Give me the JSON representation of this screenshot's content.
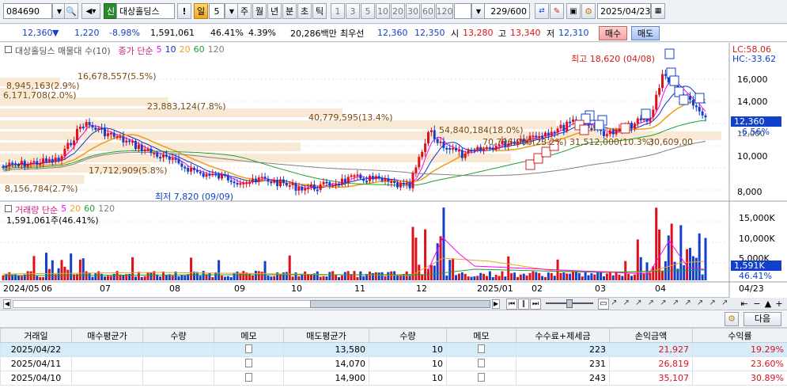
{
  "toolbar": {
    "code": "084690",
    "badge": "신",
    "name": "대상홀딩스",
    "excl": "!",
    "period_sel": "일",
    "period_num": "5",
    "periods": [
      "주",
      "월",
      "년",
      "분",
      "초",
      "틱"
    ],
    "nums": [
      "1",
      "3",
      "5",
      "10",
      "20",
      "30",
      "60",
      "120"
    ],
    "count": "229",
    "count_total": "/600",
    "date": "2025/04/23"
  },
  "quote": {
    "price": "12,360",
    "arrow": "▼",
    "change": "1,220",
    "change_pct": "-8.98%",
    "volume": "1,591,061",
    "vol_ratio": "46.41%",
    "turnover": "4.39%",
    "amount": "20,286백만",
    "best_sell_label": "최우선",
    "best_sell": "12,360",
    "best_buy": "12,350",
    "open_label": "시",
    "open": "13,280",
    "high_label": "고",
    "high": "13,340",
    "low_label": "저",
    "low": "12,310",
    "buy_btn": "매수",
    "sell_btn": "매도"
  },
  "chart": {
    "legend_title": "대상홀딩스 매물대 수(10)",
    "ma_label": "종가 단순",
    "ma_periods": [
      "5",
      "10",
      "20",
      "60",
      "120"
    ],
    "ma_colors": [
      "#ff00ff",
      "#1030d0",
      "#f0a020",
      "#20a030",
      "#808080"
    ],
    "lc": "LC:58.06",
    "hc": "HC:-33.62",
    "price_ticks": [
      "16,000",
      "14,000",
      "12,000",
      "10,000",
      "8,000"
    ],
    "current_tag": "12,360",
    "current_pct": "-6.56%",
    "high_note": "최고 18,620 (04/08)",
    "low_note": "최저 7,820 (09/09)",
    "profile_labels": [
      "16,678,557(5.5%)",
      "8,945,163(2.9%)",
      "6,171,708(2.0%)",
      "23,883,124(7.8%)",
      "40,779,595(13.4%)",
      "54,840,184(18.0%)",
      "70,796,000(23.2%)",
      "31,512,000(10.3%)",
      "17,712,909(5.8%)",
      "8,156,784(2.7%)",
      "30,609,00"
    ],
    "volume_label": "거래량 단순",
    "volume_ma": [
      "5",
      "20",
      "60",
      "120"
    ],
    "volume_sub": "1,591,061주(46.41%)",
    "volume_ticks": [
      "15,000K",
      "10,000K",
      "5,000K"
    ],
    "volume_tag": "1,591K",
    "volume_pct": "46.41%",
    "x_labels": [
      "2024/05",
      "06",
      "07",
      "08",
      "09",
      "10",
      "11",
      "12",
      "2025/01",
      "02",
      "03",
      "04",
      "04/23"
    ],
    "colors": {
      "up": "#e0101a",
      "down": "#1240c8",
      "profile": "#f7e7d0"
    }
  },
  "table": {
    "next_btn": "다음",
    "headers": [
      "거래일",
      "매수평균가",
      "수량",
      "메모",
      "매도평균가",
      "수량",
      "메모",
      "수수료+제세금",
      "손익금액",
      "수익률"
    ],
    "rows": [
      [
        "2025/04/22",
        "",
        "",
        "",
        "13,580",
        "10",
        "",
        "223",
        "21,927",
        "19.29%"
      ],
      [
        "2025/04/11",
        "",
        "",
        "",
        "14,070",
        "10",
        "",
        "231",
        "26,819",
        "23.60%"
      ],
      [
        "2025/04/10",
        "",
        "",
        "",
        "14,900",
        "10",
        "",
        "243",
        "35,107",
        "30.89%"
      ]
    ]
  }
}
